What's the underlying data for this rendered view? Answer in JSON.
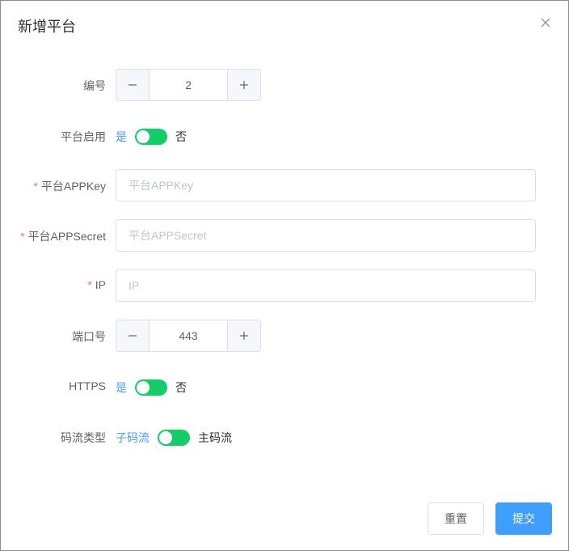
{
  "dialog": {
    "title": "新增平台",
    "close_icon": "close-icon"
  },
  "form": {
    "number": {
      "label": "编号",
      "value": "2"
    },
    "platform_enabled": {
      "label": "平台启用",
      "on_text": "是",
      "off_text": "否",
      "active_color": "#13ce66"
    },
    "app_key": {
      "required_mark": "*",
      "label": "平台APPKey",
      "value": "",
      "placeholder": "平台APPKey"
    },
    "app_secret": {
      "required_mark": "*",
      "label": "平台APPSecret",
      "value": "",
      "placeholder": "平台APPSecret"
    },
    "ip": {
      "required_mark": "*",
      "label": "IP",
      "value": "",
      "placeholder": "IP"
    },
    "port": {
      "label": "端口号",
      "value": "443"
    },
    "https": {
      "label": "HTTPS",
      "on_text": "是",
      "off_text": "否"
    },
    "stream_type": {
      "label": "码流类型",
      "left_text": "子码流",
      "right_text": "主码流"
    }
  },
  "footer": {
    "reset_label": "重置",
    "submit_label": "提交",
    "primary_color": "#409eff"
  }
}
